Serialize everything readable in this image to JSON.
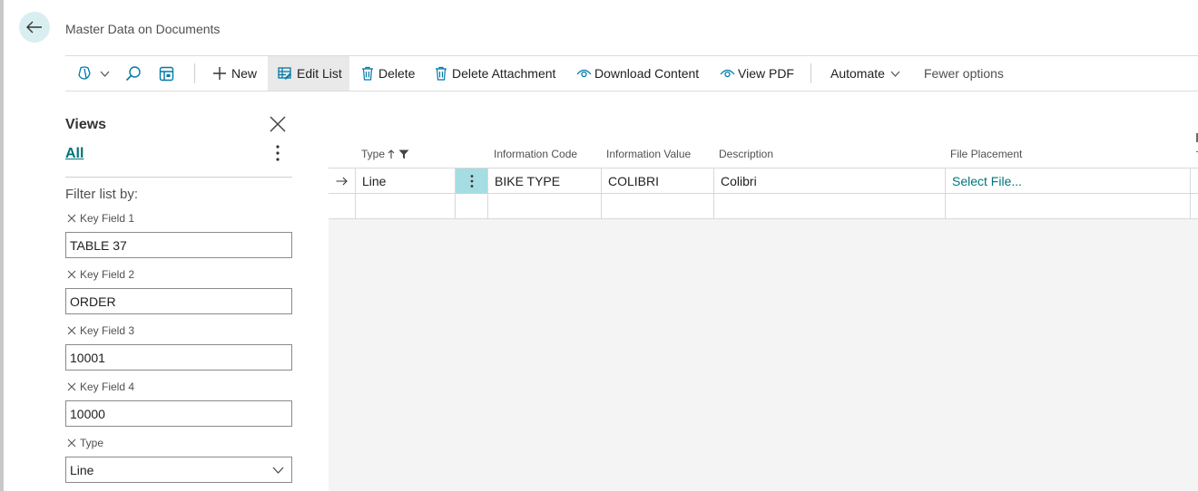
{
  "header": {
    "title": "Master Data on Documents"
  },
  "toolbar": {
    "new_label": "New",
    "edit_list_label": "Edit List",
    "delete_label": "Delete",
    "delete_attachment_label": "Delete Attachment",
    "download_content_label": "Download Content",
    "view_pdf_label": "View PDF",
    "automate_label": "Automate",
    "fewer_options_label": "Fewer options"
  },
  "filter_pane": {
    "views_title": "Views",
    "view_all": "All",
    "filter_by_label": "Filter list by:",
    "filters": [
      {
        "label": "Key Field 1",
        "value": "TABLE 37"
      },
      {
        "label": "Key Field 2",
        "value": "ORDER"
      },
      {
        "label": "Key Field 3",
        "value": "10001"
      },
      {
        "label": "Key Field 4",
        "value": "10000"
      },
      {
        "label": "Type",
        "value": "Line"
      }
    ]
  },
  "grid": {
    "columns": [
      "Type",
      "Information Code",
      "Information Value",
      "Description",
      "File Placement"
    ],
    "rows": [
      {
        "type": "Line",
        "information_code": "BIKE TYPE",
        "information_value": "COLIBRI",
        "description": "Colibri",
        "file_placement": "Select File..."
      }
    ]
  },
  "colors": {
    "accent": "#00757a",
    "selected_cell": "#a6dde2",
    "back_button": "#d9eef1"
  }
}
